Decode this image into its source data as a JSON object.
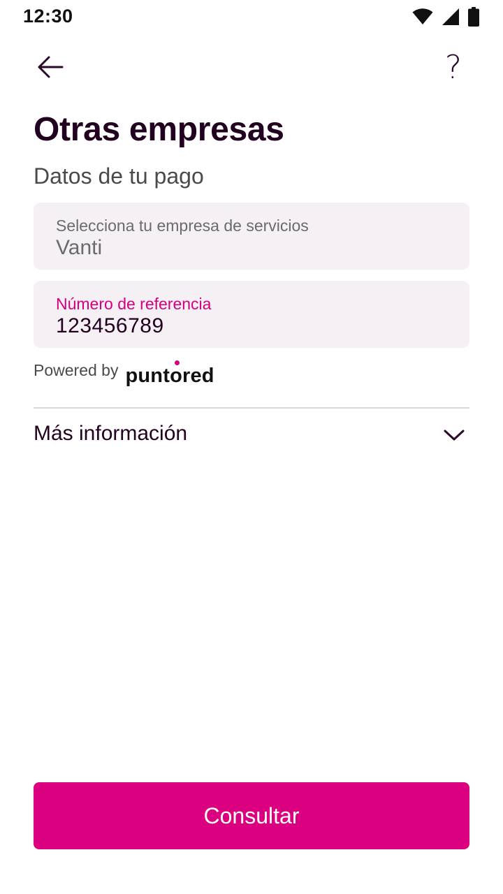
{
  "status_bar": {
    "time": "12:30",
    "icons": [
      "wifi-icon",
      "signal-icon",
      "battery-icon"
    ]
  },
  "nav": {
    "back_icon": "arrow-left-icon",
    "help_icon": "question-mark-icon",
    "help_glyph": "?"
  },
  "page": {
    "title": "Otras empresas",
    "subtitle": "Datos de tu pago"
  },
  "form": {
    "company": {
      "label": "Selecciona tu empresa de servicios",
      "value": "Vanti"
    },
    "reference": {
      "label": "Número de referencia",
      "value": "123456789"
    }
  },
  "powered_by": {
    "text": "Powered by",
    "brand": "puntored"
  },
  "more_info": {
    "label": "Más información",
    "icon": "chevron-down-icon"
  },
  "actions": {
    "submit_label": "Consultar"
  },
  "colors": {
    "accent": "#db0080",
    "field_background": "#f5f0f4",
    "title": "#22001f"
  }
}
